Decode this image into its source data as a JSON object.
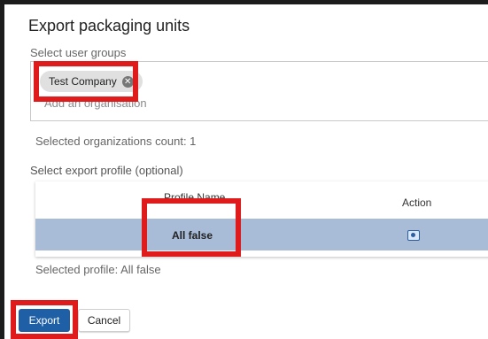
{
  "dialog": {
    "title": "Export packaging units"
  },
  "user_groups": {
    "label": "Select user groups",
    "chips": [
      {
        "label": "Test Company",
        "remove_icon": "close-circle-icon"
      }
    ],
    "input_placeholder": "Add an organisation",
    "selected_count_text": "Selected organizations count: 1"
  },
  "export_profile": {
    "label": "Select export profile (optional)",
    "columns": [
      "Profile Name",
      "Action"
    ],
    "rows": [
      {
        "name": "All false",
        "action_icon": "eye-icon",
        "selected": true
      }
    ],
    "selected_text": "Selected profile: All false"
  },
  "actions": {
    "export_label": "Export",
    "cancel_label": "Cancel"
  },
  "colors": {
    "primary": "#1f5fa6",
    "selected_row": "#a8bcd8",
    "highlight": "#e01b1b"
  }
}
